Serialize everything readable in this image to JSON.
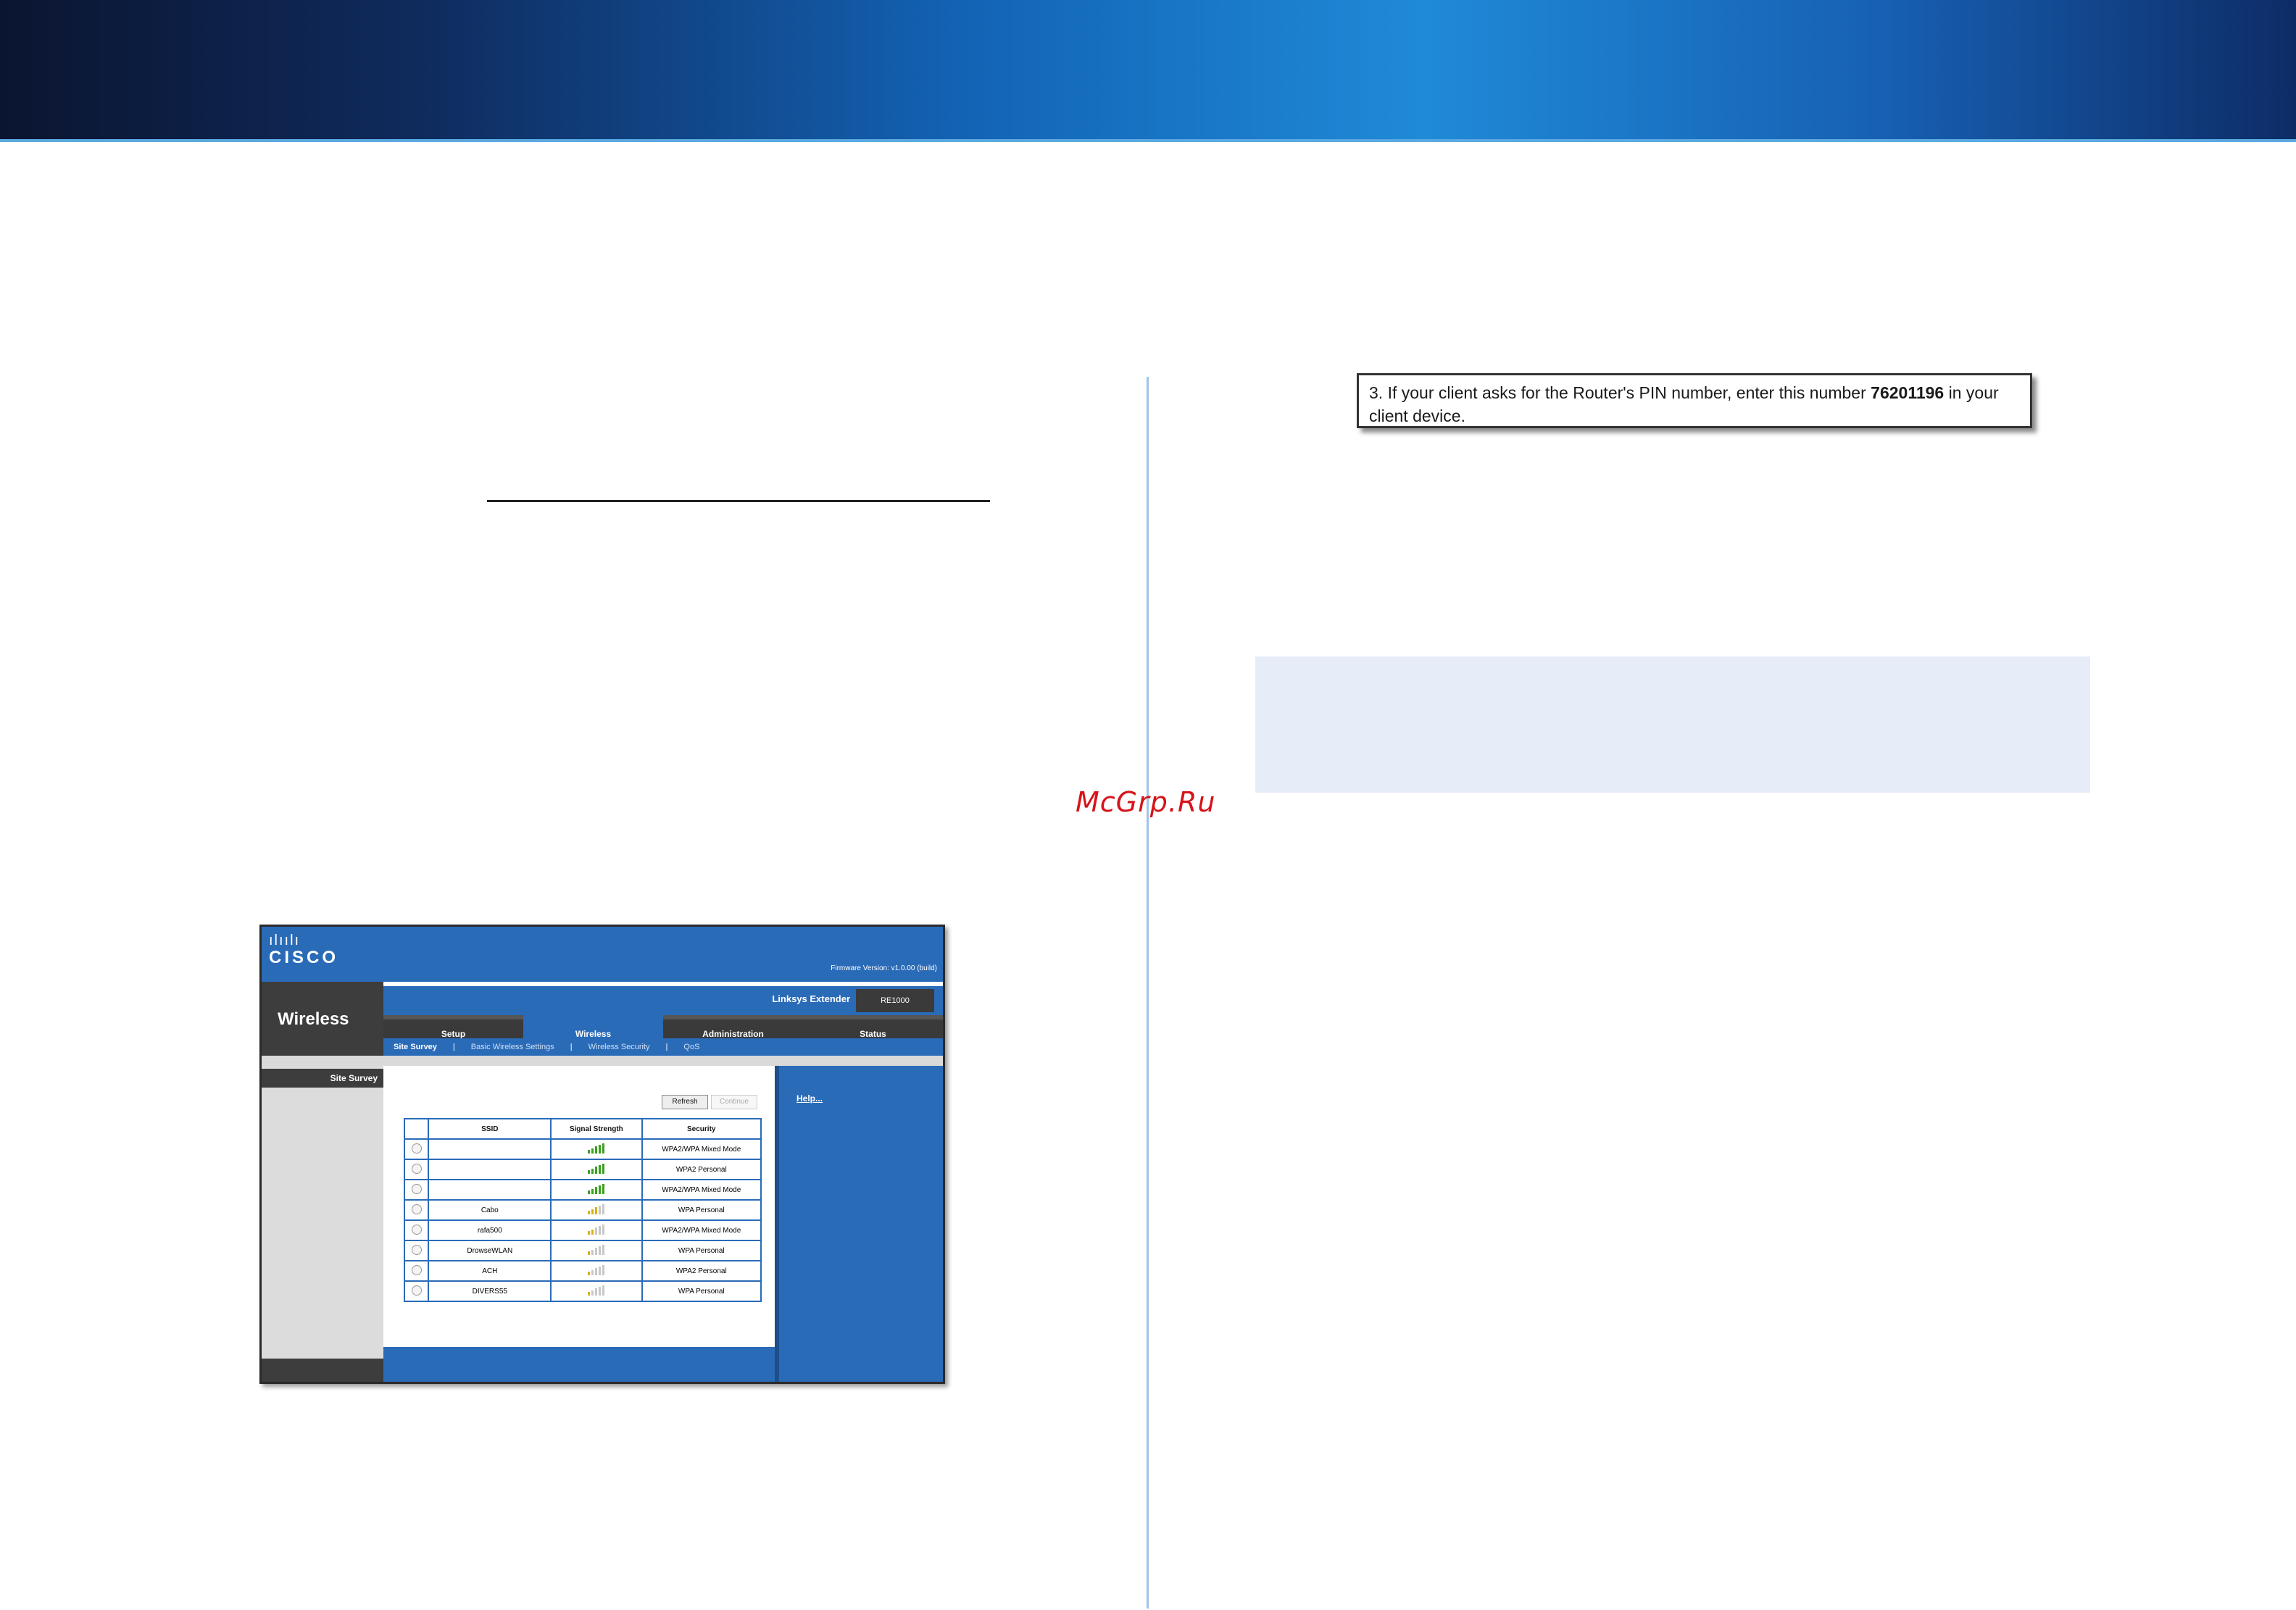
{
  "watermark": "McGrp.Ru",
  "pin_box": {
    "prefix": "3. If your client asks for the Router's PIN number, enter this number ",
    "pin": "76201196",
    "suffix_line1": " in your",
    "line2": "client device."
  },
  "router_ui": {
    "logo_bars": "ılıılı",
    "logo_word": "CISCO",
    "firmware": "Firmware Version: v1.0.00 (build)",
    "section": "Wireless",
    "product_name": "Linksys Extender",
    "model": "RE1000",
    "tabs": [
      {
        "label": "Setup",
        "active": false
      },
      {
        "label": "Wireless",
        "active": true
      },
      {
        "label": "Administration",
        "active": false
      },
      {
        "label": "Status",
        "active": false
      }
    ],
    "subtabs": [
      {
        "label": "Site Survey",
        "active": true
      },
      {
        "label": "Basic Wireless Settings",
        "active": false
      },
      {
        "label": "Wireless Security",
        "active": false
      },
      {
        "label": "QoS",
        "active": false
      }
    ],
    "left_label": "Site Survey",
    "help_link": "Help...",
    "refresh_label": "Refresh",
    "continue_label": "Continue",
    "table": {
      "headers": [
        "",
        "SSID",
        "Signal Strength",
        "Security"
      ],
      "rows": [
        {
          "ssid": "",
          "signal": 5,
          "security": "WPA2/WPA Mixed Mode"
        },
        {
          "ssid": "",
          "signal": 5,
          "security": "WPA2 Personal"
        },
        {
          "ssid": "",
          "signal": 5,
          "security": "WPA2/WPA Mixed Mode"
        },
        {
          "ssid": "Cabo",
          "signal": 3,
          "security": "WPA Personal"
        },
        {
          "ssid": "rafa500",
          "signal": 2,
          "security": "WPA2/WPA Mixed Mode"
        },
        {
          "ssid": "DrowseWLAN",
          "signal": 1,
          "security": "WPA Personal"
        },
        {
          "ssid": "ACH",
          "signal": 1,
          "security": "WPA2 Personal"
        },
        {
          "ssid": "DIVERS55",
          "signal": 1,
          "security": "WPA Personal"
        }
      ]
    }
  },
  "colors": {
    "accent": "#2a6bb8",
    "watermark": "#d6141a",
    "signal_strong": "#3aa11f",
    "signal_medium": "#d8b21a",
    "signal_empty": "#c8c8c8"
  }
}
